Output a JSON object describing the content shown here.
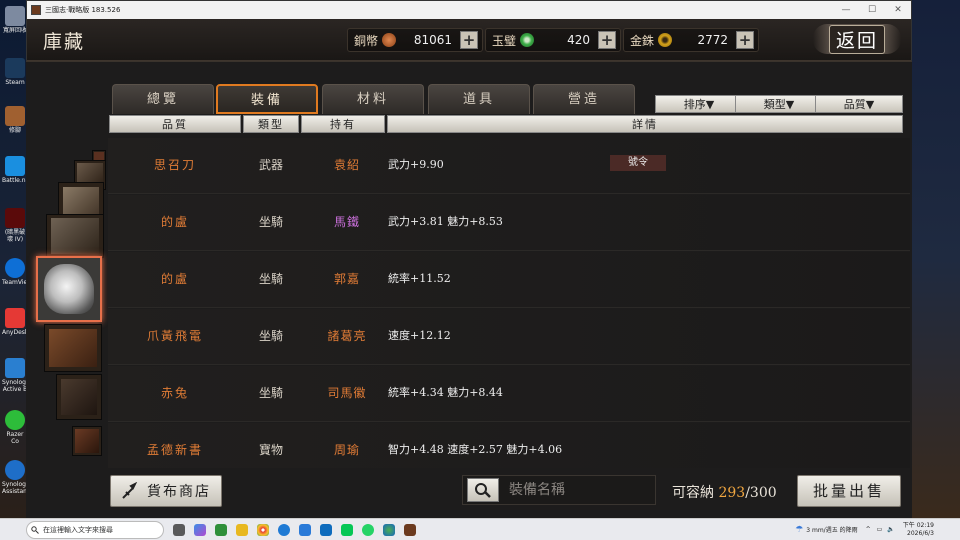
{
  "window": {
    "title": "三國志·戰略版 183.526"
  },
  "topbar": {
    "page_title": "庫藏",
    "currencies": [
      {
        "label": "銅幣",
        "value": "81061",
        "coin_color": "#b5632b"
      },
      {
        "label": "玉璧",
        "value": "420",
        "coin_color": "#3fae4a"
      },
      {
        "label": "金銖",
        "value": "2772",
        "coin_color": "#d4a21a"
      }
    ],
    "plus_label": "+",
    "back_label": "返回"
  },
  "tabs": [
    {
      "label": "總覽",
      "active": false
    },
    {
      "label": "裝備",
      "active": true
    },
    {
      "label": "材料",
      "active": false
    },
    {
      "label": "道具",
      "active": false
    },
    {
      "label": "營造",
      "active": false
    }
  ],
  "filters": [
    {
      "label": "排序▼"
    },
    {
      "label": "類型▼"
    },
    {
      "label": "品質▼"
    }
  ],
  "columns": [
    "品質",
    "類型",
    "持有",
    "詳情"
  ],
  "rows": [
    {
      "name": "思召刀",
      "type": "武器",
      "holder": "袁紹",
      "holder_color": "#e07c36",
      "detail": "武力+9.90",
      "tag": "號令"
    },
    {
      "name": "的盧",
      "type": "坐騎",
      "holder": "馬鐵",
      "holder_color": "#c76fd8",
      "detail": "武力+3.81  魅力+8.53",
      "tag": ""
    },
    {
      "name": "的盧",
      "type": "坐騎",
      "holder": "郭嘉",
      "holder_color": "#e07c36",
      "detail": "統率+11.52",
      "tag": ""
    },
    {
      "name": "爪黃飛電",
      "type": "坐騎",
      "holder": "諸葛亮",
      "holder_color": "#e07c36",
      "detail": "速度+12.12",
      "tag": ""
    },
    {
      "name": "赤兔",
      "type": "坐騎",
      "holder": "司馬徽",
      "holder_color": "#e07c36",
      "detail": "統率+4.34  魅力+8.44",
      "tag": ""
    },
    {
      "name": "孟德新書",
      "type": "寶物",
      "holder": "周瑜",
      "holder_color": "#e07c36",
      "detail": "智力+4.48  速度+2.57  魅力+4.06",
      "tag": ""
    }
  ],
  "bottom": {
    "shop_label": "貨布商店",
    "search_placeholder": "裝備名稱",
    "capacity_label": "可容納",
    "capacity_used": "293",
    "capacity_sep": "/",
    "capacity_total": "300",
    "sell_label": "批量出售"
  },
  "taskbar": {
    "search_placeholder": "在這裡輸入文字來搜尋",
    "weather": "3 mm/週五 的降雨",
    "time": "下午 02:19",
    "date": "2026/6/3"
  },
  "desktop_icons": [
    "寬屏回收",
    "Steam",
    "修腳",
    "Battle.net",
    "(暗黑破壞 IV)",
    "TeamViewer",
    "AnyDesk",
    "Synology Active B",
    "Razer Co",
    "Synology Assistant"
  ]
}
